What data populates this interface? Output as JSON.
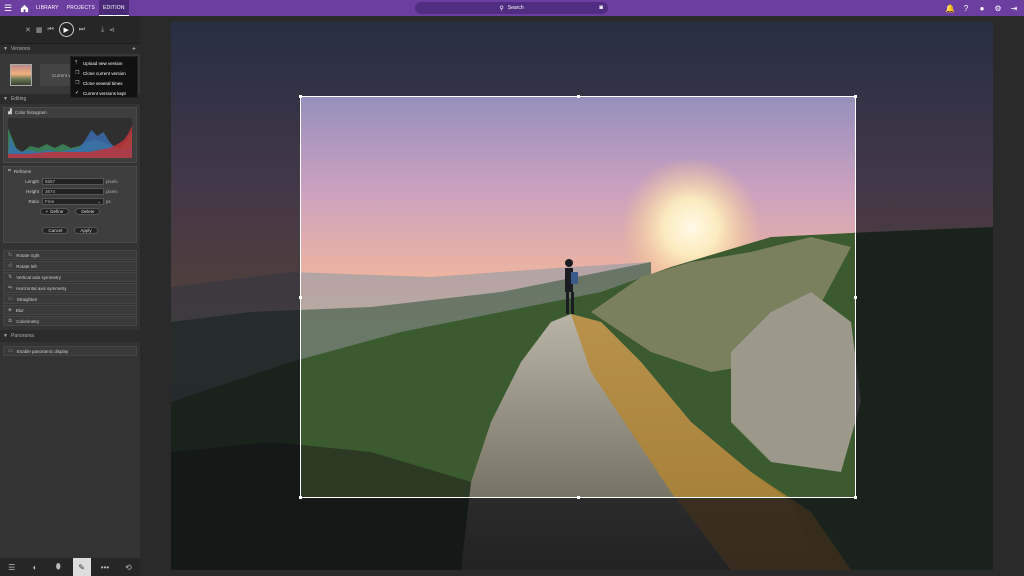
{
  "topbar": {
    "nav": [
      "LIBRARY",
      "PROJECTS",
      "EDITION"
    ],
    "active_nav": "EDITION",
    "search_placeholder": "Search",
    "accent": "#6b3fa0"
  },
  "sidebar": {
    "versions_title": "Versions",
    "current_version_label": "Current v",
    "version_menu": [
      {
        "icon": "upload-icon",
        "label": "Upload new version"
      },
      {
        "icon": "copy-icon",
        "label": "Clone current version"
      },
      {
        "icon": "copy-icon",
        "label": "Clone several times"
      },
      {
        "icon": "check-icon",
        "label": "Current versions kept"
      }
    ],
    "editing_title": "Editing",
    "histogram_title": "Color histogram",
    "resize": {
      "title": "Reframe",
      "length_label": "Length",
      "length_value": "5657",
      "length_unit": "pixels",
      "height_label": "Height",
      "height_value": "3674",
      "height_unit": "pixels",
      "ratio_label": "Ratio",
      "ratio_value": "Free",
      "ratio_unit": "px",
      "define_label": "Define",
      "delete_label": "Delete",
      "cancel_label": "Cancel",
      "apply_label": "Apply"
    },
    "tools": [
      "Rotate right",
      "Rotate left",
      "Vertical axis symmetry",
      "Horizontal axis symmetry",
      "Straighten",
      "Blur",
      "Colorimetry"
    ],
    "panorama_title": "Panorama",
    "panorama_option": "Enable panoramic display"
  }
}
